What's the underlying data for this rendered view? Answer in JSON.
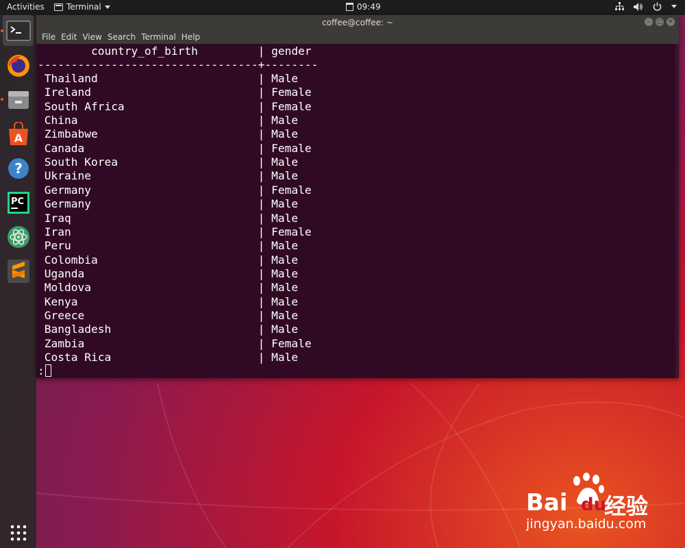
{
  "topbar": {
    "activities": "Activities",
    "app_name": "Terminal",
    "clock": "09:49",
    "tray_icons": [
      "network-icon",
      "volume-icon",
      "power-icon"
    ]
  },
  "dock": {
    "items": [
      "terminal",
      "firefox",
      "files",
      "software-center",
      "help",
      "pycharm",
      "atom",
      "sublime-text"
    ],
    "show_apps": "show-applications-icon"
  },
  "window": {
    "title": "coffee@coffee: ~",
    "menu": [
      "File",
      "Edit",
      "View",
      "Search",
      "Terminal",
      "Help"
    ]
  },
  "terminal": {
    "header": "        country_of_birth         | gender",
    "separator": "---------------------------------+--------",
    "rows": [
      {
        "country": "Thailand",
        "gender": "Male"
      },
      {
        "country": "Ireland",
        "gender": "Female"
      },
      {
        "country": "South Africa",
        "gender": "Female"
      },
      {
        "country": "China",
        "gender": "Male"
      },
      {
        "country": "Zimbabwe",
        "gender": "Male"
      },
      {
        "country": "Canada",
        "gender": "Female"
      },
      {
        "country": "South Korea",
        "gender": "Male"
      },
      {
        "country": "Ukraine",
        "gender": "Male"
      },
      {
        "country": "Germany",
        "gender": "Female"
      },
      {
        "country": "Germany",
        "gender": "Male"
      },
      {
        "country": "Iraq",
        "gender": "Male"
      },
      {
        "country": "Iran",
        "gender": "Female"
      },
      {
        "country": "Peru",
        "gender": "Male"
      },
      {
        "country": "Colombia",
        "gender": "Male"
      },
      {
        "country": "Uganda",
        "gender": "Male"
      },
      {
        "country": "Moldova",
        "gender": "Male"
      },
      {
        "country": "Kenya",
        "gender": "Male"
      },
      {
        "country": "Greece",
        "gender": "Male"
      },
      {
        "country": "Bangladesh",
        "gender": "Male"
      },
      {
        "country": "Zambia",
        "gender": "Female"
      },
      {
        "country": "Costa Rica",
        "gender": "Male"
      }
    ],
    "prompt": ":"
  },
  "watermark": {
    "brand": "Bai",
    "brand_suffix": "du",
    "cn_text": "经验",
    "url": "jingyan.baidu.com"
  },
  "colors": {
    "terminal_bg": "#300a24",
    "accent": "#e95420",
    "titlebar": "#3c3b37"
  }
}
